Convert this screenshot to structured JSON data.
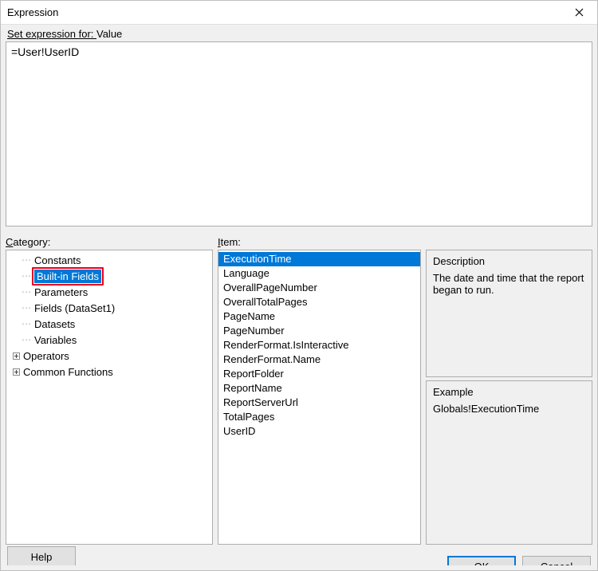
{
  "window": {
    "title": "Expression"
  },
  "setfor_label_pre": "Set expression for: ",
  "setfor_target": "Value",
  "expression_text": "=User!UserID",
  "labels": {
    "category_pre": "C",
    "category_rest": "ategory:",
    "item_pre": "I",
    "item_rest": "tem:"
  },
  "category_tree": {
    "items": [
      {
        "label": "Constants",
        "expander": "",
        "selected": false,
        "highlight": false,
        "dots": true
      },
      {
        "label": "Built-in Fields",
        "expander": "",
        "selected": true,
        "highlight": true,
        "dots": true
      },
      {
        "label": "Parameters",
        "expander": "",
        "selected": false,
        "highlight": false,
        "dots": true
      },
      {
        "label": "Fields (DataSet1)",
        "expander": "",
        "selected": false,
        "highlight": false,
        "dots": true
      },
      {
        "label": "Datasets",
        "expander": "",
        "selected": false,
        "highlight": false,
        "dots": true
      },
      {
        "label": "Variables",
        "expander": "",
        "selected": false,
        "highlight": false,
        "dots": true
      },
      {
        "label": "Operators",
        "expander": "+",
        "selected": false,
        "highlight": false,
        "dots": false
      },
      {
        "label": "Common Functions",
        "expander": "+",
        "selected": false,
        "highlight": false,
        "dots": false
      }
    ]
  },
  "item_list": [
    {
      "label": "ExecutionTime",
      "selected": true
    },
    {
      "label": "Language",
      "selected": false
    },
    {
      "label": "OverallPageNumber",
      "selected": false
    },
    {
      "label": "OverallTotalPages",
      "selected": false
    },
    {
      "label": "PageName",
      "selected": false
    },
    {
      "label": "PageNumber",
      "selected": false
    },
    {
      "label": "RenderFormat.IsInteractive",
      "selected": false
    },
    {
      "label": "RenderFormat.Name",
      "selected": false
    },
    {
      "label": "ReportFolder",
      "selected": false
    },
    {
      "label": "ReportName",
      "selected": false
    },
    {
      "label": "ReportServerUrl",
      "selected": false
    },
    {
      "label": "TotalPages",
      "selected": false
    },
    {
      "label": "UserID",
      "selected": false
    }
  ],
  "description": {
    "heading": "Description",
    "text": "The date and time that the report began to run."
  },
  "example": {
    "heading": "Example",
    "text": "Globals!ExecutionTime"
  },
  "buttons": {
    "help": "Help",
    "ok": "OK",
    "cancel": "Cancel"
  }
}
